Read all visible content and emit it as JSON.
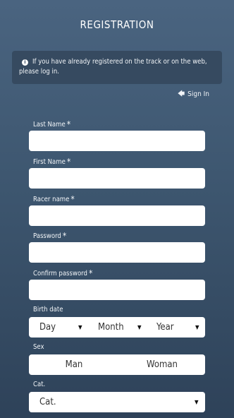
{
  "header": {
    "title": "REGISTRATION"
  },
  "info": {
    "icon": "info-icon",
    "text": "If you have already registered on the track or on the web, please log in."
  },
  "signin": {
    "icon": "arrow-left-icon",
    "label": "Sign In"
  },
  "fields": {
    "last_name": {
      "label": "Last Name",
      "required": "*",
      "value": ""
    },
    "first_name": {
      "label": "First Name",
      "required": "*",
      "value": ""
    },
    "racer_name": {
      "label": "Racer name",
      "required": "*",
      "value": ""
    },
    "password": {
      "label": "Password",
      "required": "*",
      "value": ""
    },
    "confirm_password": {
      "label": "Confirm password",
      "required": "*",
      "value": ""
    }
  },
  "birth_date": {
    "label": "Birth date",
    "day": "Day",
    "month": "Month",
    "year": "Year"
  },
  "sex": {
    "label": "Sex",
    "options": [
      "Man",
      "Woman"
    ]
  },
  "category": {
    "label": "Cat.",
    "selected": "Cat."
  }
}
